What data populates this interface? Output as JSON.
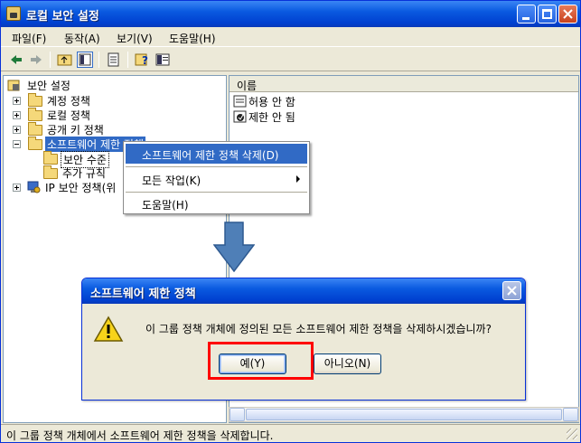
{
  "window": {
    "title": "로컬 보안 설정"
  },
  "menu": {
    "items": [
      "파일(F)",
      "동작(A)",
      "보기(V)",
      "도움말(H)"
    ]
  },
  "toolbar": {
    "buttons": [
      "back-arrow-icon",
      "up-folder-icon",
      "show-hide-tree-icon",
      "export-list-icon",
      "help-icon",
      "properties-icon"
    ]
  },
  "tree": {
    "root": "보안 설정",
    "items": [
      {
        "label": "계정 정책"
      },
      {
        "label": "로컬 정책"
      },
      {
        "label": "공개 키 정책"
      },
      {
        "label": "소프트웨어 제한 정책"
      },
      {
        "label": "보안 수준"
      },
      {
        "label": "추가 규칙"
      },
      {
        "label": "IP 보안 정책(위"
      }
    ]
  },
  "list": {
    "column": "이름",
    "rows": [
      "허용 안 함",
      "제한 안 됨"
    ]
  },
  "context_menu": {
    "items": [
      "소프트웨어 제한 정책 삭제(D)",
      "모든 작업(K)",
      "도움말(H)"
    ]
  },
  "dialog": {
    "title": "소프트웨어 제한 정책",
    "message": "이 그룹 정책 개체에 정의된 모든 소프트웨어 제한 정책을 삭제하시겠습니까?",
    "yes_label": "예(Y)",
    "no_label": "아니오(N)"
  },
  "status": {
    "text": "이 그룹 정책 개체에서 소프트웨어 제한 정책을 삭제합니다."
  },
  "colors": {
    "titlebar": "#0a5ae0",
    "selection": "#316ac5",
    "highlight_box": "#ff0000",
    "arrow": "#4f7fb7"
  }
}
